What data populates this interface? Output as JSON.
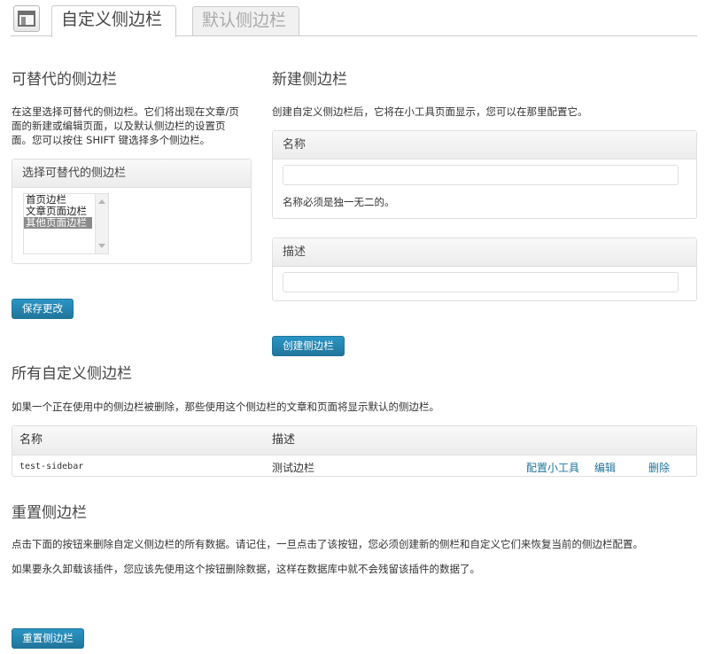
{
  "header": {
    "tabs": [
      {
        "label": "自定义侧边栏",
        "active": true
      },
      {
        "label": "默认侧边栏",
        "active": false
      }
    ]
  },
  "replaceable": {
    "title": "可替代的侧边栏",
    "desc_line1": "在这里选择可替代的侧边栏。它们将出现在文章/页",
    "desc_line2": "面的新建或编辑页面，以及默认侧边栏的设置页",
    "desc_line3": "面。您可以按住 SHIFT 键选择多个侧边栏。",
    "box_title": "选择可替代的侧边栏",
    "options": [
      {
        "label": "首页边栏",
        "selected": false
      },
      {
        "label": "文章页面边栏",
        "selected": false
      },
      {
        "label": "其他页面边栏",
        "selected": true
      }
    ],
    "save_label": "保存更改"
  },
  "new_sidebar": {
    "title": "新建侧边栏",
    "desc": "创建自定义侧边栏后，它将在小工具页面显示，您可以在那里配置它。",
    "name_label": "名称",
    "name_value": "",
    "name_hint": "名称必须是独一无二的。",
    "desc_label": "描述",
    "desc_value": "",
    "create_label": "创建侧边栏"
  },
  "all_sidebars": {
    "title": "所有自定义侧边栏",
    "desc": "如果一个正在使用中的侧边栏被删除，那些使用这个侧边栏的文章和页面将显示默认的侧边栏。",
    "columns": [
      "名称",
      "描述"
    ],
    "rows": [
      {
        "name": "test-sidebar",
        "description": "测试边栏",
        "configure": "配置小工具",
        "edit": "编辑",
        "delete": "删除"
      }
    ]
  },
  "reset": {
    "title": "重置侧边栏",
    "desc1": "点击下面的按钮来删除自定义侧边栏的所有数据。请记住，一旦点击了该按钮，您必须创建新的侧栏和自定义它们来恢复当前的侧边栏配置。",
    "desc2": "如果要永久卸载该插件，您应该先使用这个按钮删除数据，这样在数据库中就不会残留该插件的数据了。",
    "button_label": "重置侧边栏"
  },
  "colors": {
    "accent": "#21759b",
    "button_top": "#2a95c5"
  }
}
